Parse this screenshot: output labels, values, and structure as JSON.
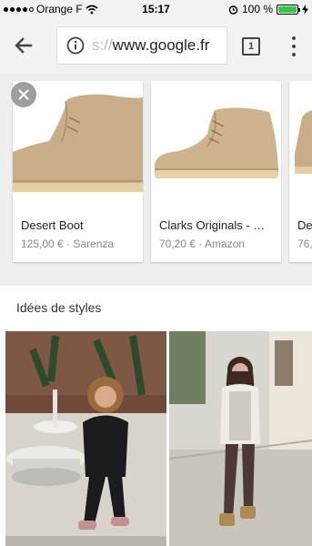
{
  "status_bar": {
    "carrier": "Orange F",
    "time": "15:17",
    "battery": "100 %",
    "battery_level": 1.0
  },
  "toolbar": {
    "url_faded": "s://",
    "url_main": "www.google.fr",
    "tab_count": "1",
    "icons": [
      "back-arrow-icon",
      "info-icon",
      "tabs-icon",
      "overflow-menu-icon"
    ]
  },
  "products": [
    {
      "title": "Desert Boot",
      "price": "125,00 €",
      "seller": "Sarenza",
      "subtitle": "125,00 € · Sarenza"
    },
    {
      "title": "Clarks Originals - …",
      "price": "70,20 €",
      "seller": "Amazon",
      "subtitle": "70,20 € · Amazon"
    },
    {
      "title": "De",
      "price": "76,",
      "seller": "",
      "subtitle": "76,"
    }
  ],
  "styles_section": {
    "title": "Idées de styles"
  },
  "colors": {
    "chrome_bg": "#f2f2f2",
    "battery_green": "#35c84a",
    "boot_tan": "#c9ae8a",
    "sole": "#e4cfa0"
  }
}
